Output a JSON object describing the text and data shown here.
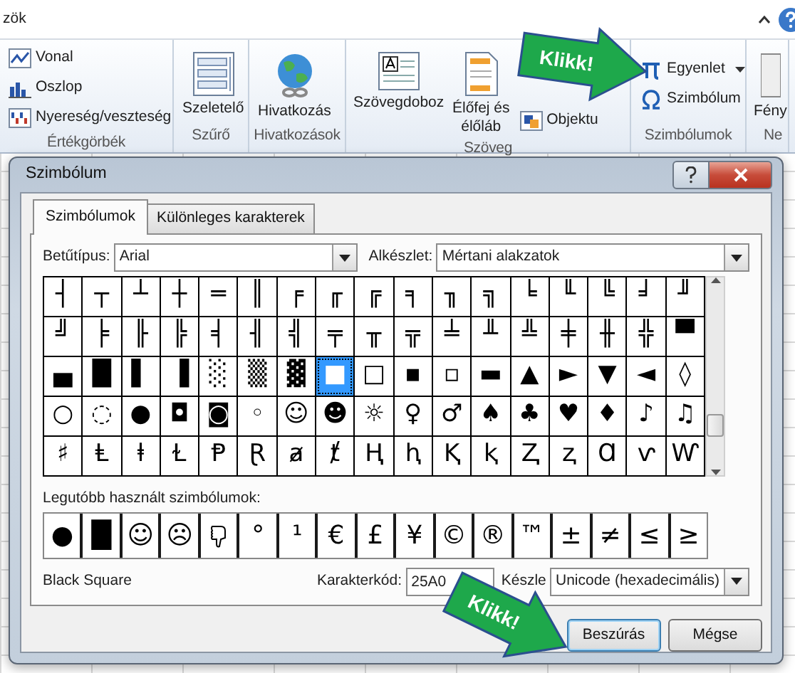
{
  "ribbon": {
    "title_fragment": "zök",
    "groups": [
      {
        "label": "Értékgörbék",
        "items": [
          {
            "kind": "small",
            "label": "Vonal"
          },
          {
            "kind": "small",
            "label": "Oszlop"
          },
          {
            "kind": "small",
            "label": "Nyereség/veszteség"
          }
        ]
      },
      {
        "label": "Szűrő",
        "items": [
          {
            "kind": "large",
            "label": "Szeletelő"
          }
        ]
      },
      {
        "label": "Hivatkozások",
        "items": [
          {
            "kind": "large",
            "label": "Hivatkozás"
          }
        ]
      },
      {
        "label": "Szöveg",
        "items": [
          {
            "kind": "large",
            "label": "Szövegdoboz"
          },
          {
            "kind": "large",
            "label": "Élőfej és élőláb"
          },
          {
            "kind": "small",
            "label": "Objektu"
          }
        ]
      },
      {
        "label": "Szimbólumok",
        "items": [
          {
            "kind": "small",
            "label": "Egyenlet",
            "dropdown": true
          },
          {
            "kind": "small",
            "label": "Szimbólum",
            "dropdown": false
          }
        ]
      },
      {
        "label": "Ne",
        "items": [
          {
            "kind": "large",
            "label": "Fény"
          }
        ]
      }
    ]
  },
  "dialog": {
    "title": "Szimbólum",
    "tabs": [
      {
        "label": "Szimbólumok",
        "selected": true
      },
      {
        "label": "Különleges karakterek",
        "selected": false
      }
    ],
    "font": {
      "label": "Betűtípus:",
      "value": "Arial"
    },
    "subset": {
      "label": "Alkészlet:",
      "value": "Mértani alakzatok"
    },
    "symbol_rows": [
      [
        {
          "char": "┤",
          "selected": false
        },
        {
          "char": "┬",
          "selected": false
        },
        {
          "char": "┴",
          "selected": false
        },
        {
          "char": "┼",
          "selected": false
        },
        {
          "char": "═",
          "selected": false
        },
        {
          "char": "║",
          "selected": false
        },
        {
          "char": "╒",
          "selected": false
        },
        {
          "char": "╓",
          "selected": false
        },
        {
          "char": "╔",
          "selected": false
        },
        {
          "char": "╕",
          "selected": false
        },
        {
          "char": "╖",
          "selected": false
        },
        {
          "char": "╗",
          "selected": false
        },
        {
          "char": "╘",
          "selected": false
        },
        {
          "char": "╙",
          "selected": false
        },
        {
          "char": "╚",
          "selected": false
        },
        {
          "char": "╛",
          "selected": false
        },
        {
          "char": "╜",
          "selected": false
        }
      ],
      [
        {
          "char": "╝",
          "selected": false
        },
        {
          "char": "╞",
          "selected": false
        },
        {
          "char": "╟",
          "selected": false
        },
        {
          "char": "╠",
          "selected": false
        },
        {
          "char": "╡",
          "selected": false
        },
        {
          "char": "╢",
          "selected": false
        },
        {
          "char": "╣",
          "selected": false
        },
        {
          "char": "╤",
          "selected": false
        },
        {
          "char": "╥",
          "selected": false
        },
        {
          "char": "╦",
          "selected": false
        },
        {
          "char": "╧",
          "selected": false
        },
        {
          "char": "╨",
          "selected": false
        },
        {
          "char": "╩",
          "selected": false
        },
        {
          "char": "╪",
          "selected": false
        },
        {
          "char": "╫",
          "selected": false
        },
        {
          "char": "╬",
          "selected": false
        },
        {
          "char": "▀",
          "selected": false
        }
      ],
      [
        {
          "char": "▄",
          "selected": false
        },
        {
          "char": "█",
          "selected": false
        },
        {
          "char": "▌",
          "selected": false
        },
        {
          "char": "▐",
          "selected": false
        },
        {
          "char": "░",
          "selected": false
        },
        {
          "char": "▒",
          "selected": false
        },
        {
          "char": "▓",
          "selected": false
        },
        {
          "char": "■",
          "selected": true
        },
        {
          "char": "□",
          "selected": false
        },
        {
          "char": "▪",
          "selected": false
        },
        {
          "char": "▫",
          "selected": false
        },
        {
          "char": "▬",
          "selected": false
        },
        {
          "char": "▲",
          "selected": false
        },
        {
          "char": "►",
          "selected": false
        },
        {
          "char": "▼",
          "selected": false
        },
        {
          "char": "◄",
          "selected": false
        },
        {
          "char": "◊",
          "selected": false
        }
      ],
      [
        {
          "char": "○",
          "selected": false
        },
        {
          "char": "◌",
          "selected": false
        },
        {
          "char": "●",
          "selected": false
        },
        {
          "char": "◘",
          "selected": false
        },
        {
          "char": "◙",
          "selected": false
        },
        {
          "char": "◦",
          "selected": false
        },
        {
          "char": "☺",
          "selected": false
        },
        {
          "char": "☻",
          "selected": false
        },
        {
          "char": "☼",
          "selected": false
        },
        {
          "char": "♀",
          "selected": false
        },
        {
          "char": "♂",
          "selected": false
        },
        {
          "char": "♠",
          "selected": false
        },
        {
          "char": "♣",
          "selected": false
        },
        {
          "char": "♥",
          "selected": false
        },
        {
          "char": "♦",
          "selected": false
        },
        {
          "char": "♪",
          "selected": false
        },
        {
          "char": "♫",
          "selected": false
        }
      ],
      [
        {
          "char": "♯",
          "selected": false
        },
        {
          "char": "Ⱡ",
          "selected": false
        },
        {
          "char": "ⱡ",
          "selected": false
        },
        {
          "char": "Ɫ",
          "selected": false
        },
        {
          "char": "Ᵽ",
          "selected": false
        },
        {
          "char": "Ɽ",
          "selected": false
        },
        {
          "char": "ⱥ",
          "selected": false
        },
        {
          "char": "ⱦ",
          "selected": false
        },
        {
          "char": "Ⱨ",
          "selected": false
        },
        {
          "char": "ⱨ",
          "selected": false
        },
        {
          "char": "Ⱪ",
          "selected": false
        },
        {
          "char": "ⱪ",
          "selected": false
        },
        {
          "char": "Ⱬ",
          "selected": false
        },
        {
          "char": "ⱬ",
          "selected": false
        },
        {
          "char": "Ɑ",
          "selected": false
        },
        {
          "char": "ⱱ",
          "selected": false
        },
        {
          "char": "Ⱳ",
          "selected": false
        }
      ]
    ],
    "recent_label": "Legutóbb használt szimbólumok:",
    "recent": [
      {
        "kind": "char",
        "char": "●"
      },
      {
        "kind": "char",
        "char": "█"
      },
      {
        "kind": "char",
        "char": "☺"
      },
      {
        "kind": "char",
        "char": "☹"
      },
      {
        "kind": "icon"
      },
      {
        "kind": "char",
        "char": "°"
      },
      {
        "kind": "char",
        "char": "¹"
      },
      {
        "kind": "char",
        "char": "€"
      },
      {
        "kind": "char",
        "char": "£"
      },
      {
        "kind": "char",
        "char": "¥"
      },
      {
        "kind": "char",
        "char": "©"
      },
      {
        "kind": "char",
        "char": "®"
      },
      {
        "kind": "char",
        "char": "™"
      },
      {
        "kind": "char",
        "char": "±"
      },
      {
        "kind": "char",
        "char": "≠"
      },
      {
        "kind": "char",
        "char": "≤"
      },
      {
        "kind": "char",
        "char": "≥"
      }
    ],
    "character_name": "Black Square",
    "code": {
      "label": "Karakterkód:",
      "value": "25A0"
    },
    "charset": {
      "label": "Készle",
      "value": "Unicode (hexadecimális)"
    },
    "buttons": [
      {
        "label": "Beszúrás",
        "default": true
      },
      {
        "label": "Mégse",
        "default": false
      }
    ]
  },
  "callouts": [
    {
      "text": "Klikk!"
    },
    {
      "text": "Klikk!"
    }
  ]
}
